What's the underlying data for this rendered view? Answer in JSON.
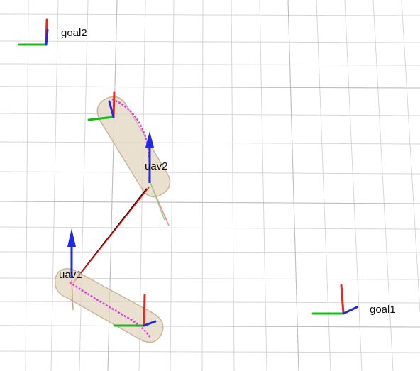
{
  "scene": {
    "labels": {
      "goal2": "goal2",
      "uav2": "uav2",
      "uav1": "uav1",
      "goal1": "goal1"
    }
  },
  "colors": {
    "background": "#ffffff",
    "grid": "#d6d6d6",
    "grid_dark": "#bdbdbd",
    "axis_x": "#e8281e",
    "axis_y": "#18b818",
    "axis_z": "#1e2ae8",
    "path": "#e040e0",
    "capsule_fill": "#e3d6bf",
    "capsule_stroke": "#c8b79a",
    "link_red": "#ff1010",
    "link_black": "#000000"
  },
  "icons": {
    "goal_frame": "axes-frame-icon",
    "uav_frame": "axes-frame-icon",
    "uav_arrow": "arrow-up-icon"
  }
}
